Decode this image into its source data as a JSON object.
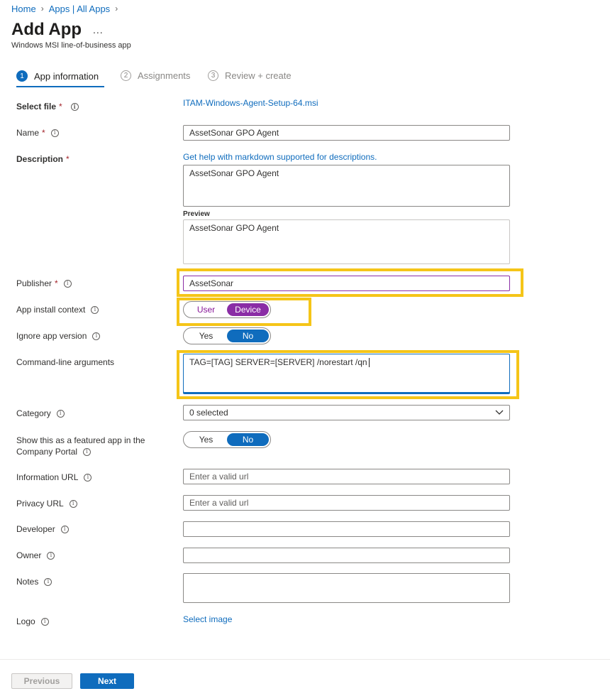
{
  "breadcrumb": {
    "home": "Home",
    "apps": "Apps | All Apps"
  },
  "page": {
    "title": "Add App",
    "more": "...",
    "subtitle": "Windows MSI line-of-business app"
  },
  "steps": [
    {
      "num": "1",
      "label": "App information"
    },
    {
      "num": "2",
      "label": "Assignments"
    },
    {
      "num": "3",
      "label": "Review + create"
    }
  ],
  "form": {
    "select_file": {
      "label": "Select file",
      "required": "*",
      "value": "ITAM-Windows-Agent-Setup-64.msi"
    },
    "name": {
      "label": "Name",
      "required": "*",
      "value": "AssetSonar GPO Agent"
    },
    "description": {
      "label": "Description",
      "required": "*",
      "help_link": "Get help with markdown supported for descriptions.",
      "value": "AssetSonar GPO Agent",
      "preview_label": "Preview",
      "preview_value": "AssetSonar GPO Agent"
    },
    "publisher": {
      "label": "Publisher",
      "required": "*",
      "value": "AssetSonar"
    },
    "install_context": {
      "label": "App install context",
      "option_user": "User",
      "option_device": "Device",
      "selected": "Device"
    },
    "ignore_version": {
      "label": "Ignore app version",
      "option_yes": "Yes",
      "option_no": "No",
      "selected": "No"
    },
    "cmd_args": {
      "label": "Command-line arguments",
      "value": "TAG=[TAG] SERVER=[SERVER] /norestart /qn"
    },
    "category": {
      "label": "Category",
      "value": "0 selected"
    },
    "featured": {
      "label_line1": "Show this as a featured app in the",
      "label_line2": "Company Portal",
      "option_yes": "Yes",
      "option_no": "No",
      "selected": "No"
    },
    "info_url": {
      "label": "Information URL",
      "placeholder": "Enter a valid url"
    },
    "privacy_url": {
      "label": "Privacy URL",
      "placeholder": "Enter a valid url"
    },
    "developer": {
      "label": "Developer",
      "value": ""
    },
    "owner": {
      "label": "Owner",
      "value": ""
    },
    "notes": {
      "label": "Notes",
      "value": ""
    },
    "logo": {
      "label": "Logo",
      "link": "Select image"
    }
  },
  "footer": {
    "previous": "Previous",
    "next": "Next"
  },
  "icons": {
    "info": "info-icon",
    "chevron": "chevron-down-icon",
    "breadcrumb_sep": "chevron-right-icon"
  },
  "colors": {
    "accent": "#0f6cbd",
    "highlight": "#f5c518",
    "toggle_purple": "#8a2da5",
    "required": "#a4262c"
  }
}
